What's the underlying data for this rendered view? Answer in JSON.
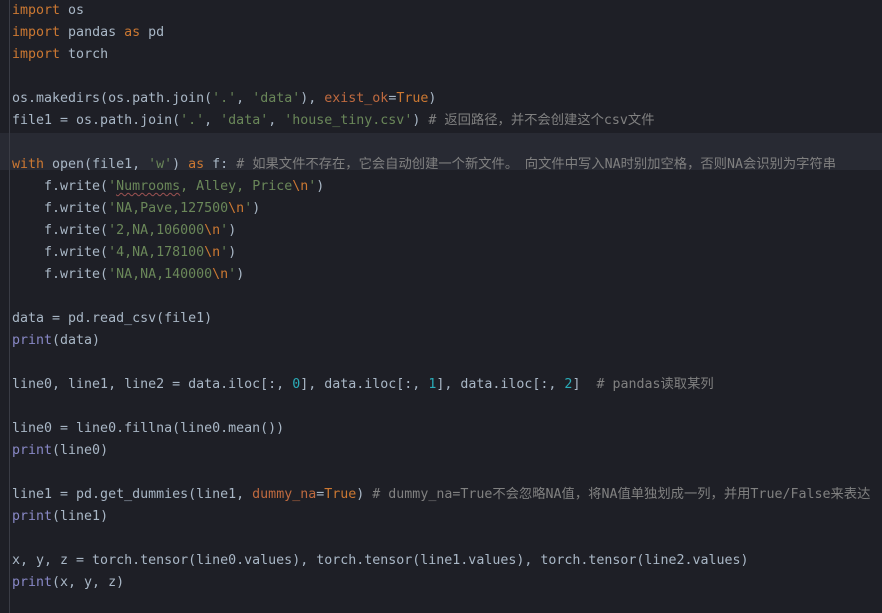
{
  "editor": {
    "name": "python-code-editor",
    "language": "Python",
    "theme": "darcula-dark",
    "background_color": "#1e1f26",
    "highlight_band_color": "#282a33",
    "colors": {
      "keyword": "#cc7832",
      "string": "#6a8759",
      "number": "#2aacb8",
      "comment": "#808080",
      "builtin_function": "#8888c6",
      "identifier": "#a9b7c6",
      "keyword_argument": "#bf6a3f",
      "spellcheck_squiggle": "#9d5252"
    }
  },
  "lines": [
    {
      "id": 1,
      "tokens": [
        {
          "t": "import",
          "c": "kw"
        },
        {
          "t": " os",
          "c": "plain"
        }
      ]
    },
    {
      "id": 2,
      "tokens": [
        {
          "t": "import",
          "c": "kw"
        },
        {
          "t": " pandas ",
          "c": "plain"
        },
        {
          "t": "as",
          "c": "kw"
        },
        {
          "t": " pd",
          "c": "plain"
        }
      ]
    },
    {
      "id": 3,
      "tokens": [
        {
          "t": "import",
          "c": "kw"
        },
        {
          "t": " torch",
          "c": "plain"
        }
      ]
    },
    {
      "id": 4,
      "tokens": []
    },
    {
      "id": 5,
      "tokens": [
        {
          "t": "os.makedirs(os.path.join(",
          "c": "plain"
        },
        {
          "t": "'.'",
          "c": "str"
        },
        {
          "t": ", ",
          "c": "plain"
        },
        {
          "t": "'data'",
          "c": "str"
        },
        {
          "t": "), ",
          "c": "plain"
        },
        {
          "t": "exist_ok",
          "c": "kwarg"
        },
        {
          "t": "=",
          "c": "plain"
        },
        {
          "t": "True",
          "c": "bool"
        },
        {
          "t": ")",
          "c": "plain"
        }
      ]
    },
    {
      "id": 6,
      "tokens": [
        {
          "t": "file1 = os.path.join(",
          "c": "plain"
        },
        {
          "t": "'.'",
          "c": "str"
        },
        {
          "t": ", ",
          "c": "plain"
        },
        {
          "t": "'data'",
          "c": "str"
        },
        {
          "t": ", ",
          "c": "plain"
        },
        {
          "t": "'house_tiny.csv'",
          "c": "str"
        },
        {
          "t": ") ",
          "c": "plain"
        },
        {
          "t": "# 返回路径，并不会创建这个csv文件",
          "c": "com"
        }
      ]
    },
    {
      "id": 7,
      "tokens": [],
      "highlight": true
    },
    {
      "id": 8,
      "highlight": true,
      "tokens": [
        {
          "t": "with",
          "c": "kw"
        },
        {
          "t": " open(file1, ",
          "c": "plain"
        },
        {
          "t": "'w'",
          "c": "str"
        },
        {
          "t": ") ",
          "c": "plain"
        },
        {
          "t": "as",
          "c": "kw"
        },
        {
          "t": " f: ",
          "c": "plain"
        },
        {
          "t": "# 如果文件不存在，它会自动创建一个新文件。　向文件中写入NA时别加空格，否则NA会识别为字符串",
          "c": "com"
        }
      ]
    },
    {
      "id": 9,
      "tokens": [
        {
          "t": "    f.write(",
          "c": "plain"
        },
        {
          "t": "'",
          "c": "str"
        },
        {
          "t": "Numrooms",
          "c": "str squiggle"
        },
        {
          "t": ", Alley, Price",
          "c": "str"
        },
        {
          "t": "\\n",
          "c": "esc"
        },
        {
          "t": "'",
          "c": "str"
        },
        {
          "t": ")",
          "c": "plain"
        }
      ]
    },
    {
      "id": 10,
      "tokens": [
        {
          "t": "    f.write(",
          "c": "plain"
        },
        {
          "t": "'NA,Pave,127500",
          "c": "str"
        },
        {
          "t": "\\n",
          "c": "esc"
        },
        {
          "t": "'",
          "c": "str"
        },
        {
          "t": ")",
          "c": "plain"
        }
      ]
    },
    {
      "id": 11,
      "tokens": [
        {
          "t": "    f.write(",
          "c": "plain"
        },
        {
          "t": "'2,NA,106000",
          "c": "str"
        },
        {
          "t": "\\n",
          "c": "esc"
        },
        {
          "t": "'",
          "c": "str"
        },
        {
          "t": ")",
          "c": "plain"
        }
      ]
    },
    {
      "id": 12,
      "tokens": [
        {
          "t": "    f.write(",
          "c": "plain"
        },
        {
          "t": "'4,NA,178100",
          "c": "str"
        },
        {
          "t": "\\n",
          "c": "esc"
        },
        {
          "t": "'",
          "c": "str"
        },
        {
          "t": ")",
          "c": "plain"
        }
      ]
    },
    {
      "id": 13,
      "tokens": [
        {
          "t": "    f.write(",
          "c": "plain"
        },
        {
          "t": "'NA,NA,140000",
          "c": "str"
        },
        {
          "t": "\\n",
          "c": "esc"
        },
        {
          "t": "'",
          "c": "str"
        },
        {
          "t": ")",
          "c": "plain"
        }
      ]
    },
    {
      "id": 14,
      "tokens": []
    },
    {
      "id": 15,
      "tokens": [
        {
          "t": "data = pd.read_csv(file1)",
          "c": "plain"
        }
      ]
    },
    {
      "id": 16,
      "tokens": [
        {
          "t": "print",
          "c": "fn"
        },
        {
          "t": "(data)",
          "c": "plain"
        }
      ]
    },
    {
      "id": 17,
      "tokens": []
    },
    {
      "id": 18,
      "tokens": [
        {
          "t": "line0, line1, line2 = data.iloc[:, ",
          "c": "plain"
        },
        {
          "t": "0",
          "c": "num"
        },
        {
          "t": "], data.iloc[:, ",
          "c": "plain"
        },
        {
          "t": "1",
          "c": "num"
        },
        {
          "t": "], data.iloc[:, ",
          "c": "plain"
        },
        {
          "t": "2",
          "c": "num"
        },
        {
          "t": "]  ",
          "c": "plain"
        },
        {
          "t": "# pandas读取某列",
          "c": "com"
        }
      ]
    },
    {
      "id": 19,
      "tokens": []
    },
    {
      "id": 20,
      "tokens": [
        {
          "t": "line0 = line0.fillna(line0.mean())",
          "c": "plain"
        }
      ]
    },
    {
      "id": 21,
      "tokens": [
        {
          "t": "print",
          "c": "fn"
        },
        {
          "t": "(line0)",
          "c": "plain"
        }
      ]
    },
    {
      "id": 22,
      "tokens": []
    },
    {
      "id": 23,
      "tokens": [
        {
          "t": "line1 = pd.get_dummies(line1, ",
          "c": "plain"
        },
        {
          "t": "dummy_na",
          "c": "kwarg"
        },
        {
          "t": "=",
          "c": "plain"
        },
        {
          "t": "True",
          "c": "bool"
        },
        {
          "t": ") ",
          "c": "plain"
        },
        {
          "t": "# dummy_na=True不会忽略NA值，将NA值单独划成一列，并用True/False来表达",
          "c": "com"
        }
      ]
    },
    {
      "id": 24,
      "tokens": [
        {
          "t": "print",
          "c": "fn"
        },
        {
          "t": "(line1)",
          "c": "plain"
        }
      ]
    },
    {
      "id": 25,
      "tokens": []
    },
    {
      "id": 26,
      "tokens": [
        {
          "t": "x, y, z = torch.tensor(line0.values), torch.tensor(line1.values), torch.tensor(line2.values)",
          "c": "plain"
        }
      ]
    },
    {
      "id": 27,
      "tokens": [
        {
          "t": "print",
          "c": "fn"
        },
        {
          "t": "(x, y, z)",
          "c": "plain"
        }
      ]
    }
  ]
}
